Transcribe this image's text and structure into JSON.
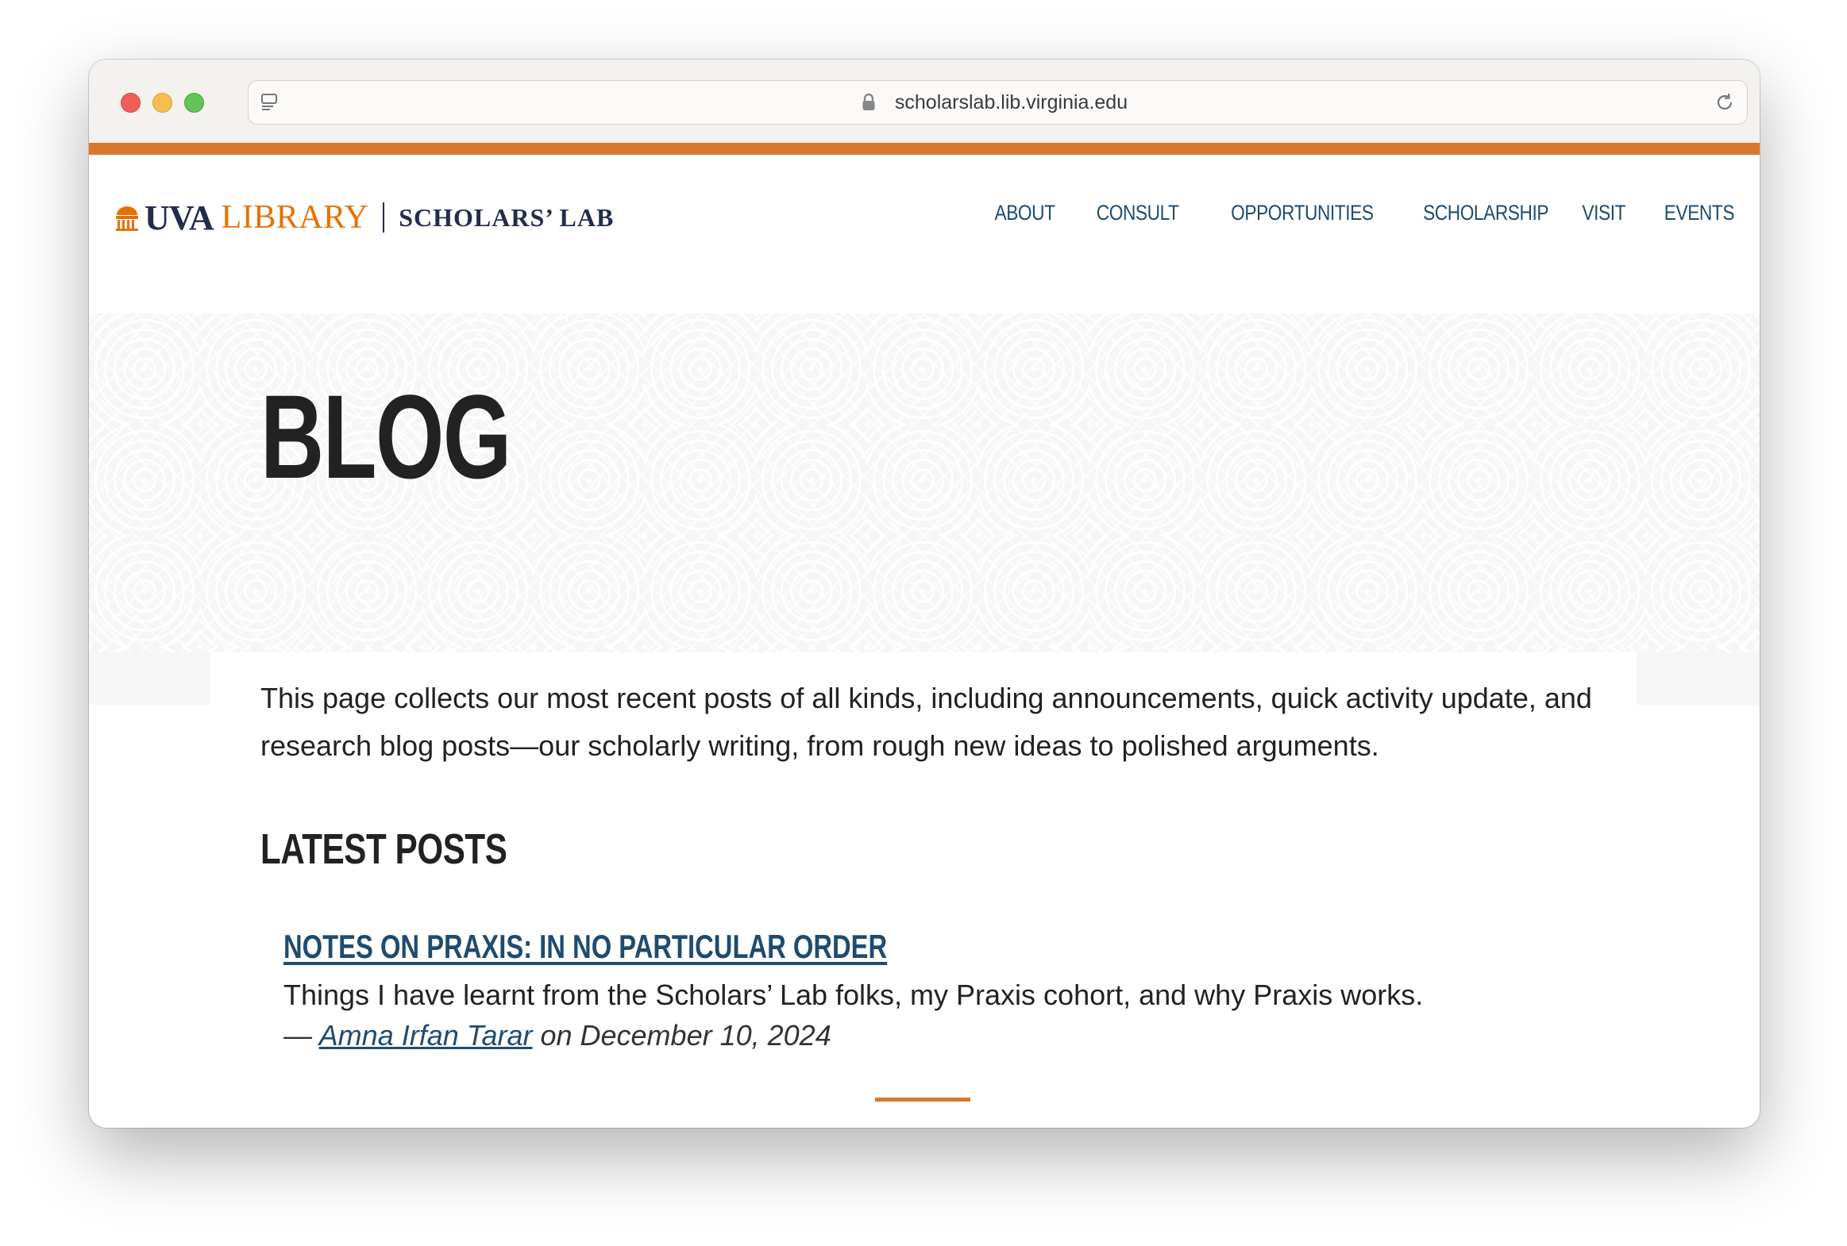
{
  "browser": {
    "url": "scholarslab.lib.virginia.edu"
  },
  "site": {
    "logo_uva": "UVA",
    "logo_library": "LIBRARY",
    "logo_scholars": "SCHOLARS’ LAB",
    "nav": [
      "ABOUT",
      "CONSULT",
      "OPPORTUNITIES",
      "SCHOLARSHIP",
      "VISIT",
      "EVENTS"
    ]
  },
  "hero": {
    "title": "BLOG"
  },
  "main": {
    "intro": "This page collects our most recent posts of all kinds, including announcements, quick activity update, and research blog posts—our scholarly writing, from rough new ideas to polished arguments.",
    "latest_heading": "LATEST POSTS",
    "posts": [
      {
        "title": "NOTES ON PRAXIS: IN NO PARTICULAR ORDER",
        "summary": "Things I have learnt from the Scholars’ Lab folks, my Praxis cohort, and why Praxis works.",
        "dash": "— ",
        "author": "Amna Irfan Tarar",
        "date_text": " on December 10, 2024"
      }
    ]
  },
  "colors": {
    "accent_orange": "#d9772c",
    "navy": "#232d4b",
    "link_blue": "#1f4b6e",
    "uva_orange": "#e57200"
  }
}
